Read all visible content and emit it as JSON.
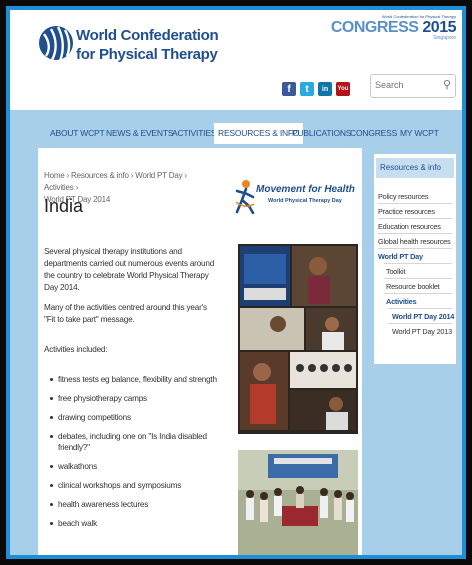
{
  "header": {
    "org_name_line1": "World Confederation",
    "org_name_line2": "for Physical Therapy",
    "congress_tiny": "World Confederation for Physical Therapy",
    "congress_word": "CONGRESS",
    "congress_year": "2015",
    "congress_city": "Singapore",
    "social": [
      "f",
      "t",
      "in",
      "You"
    ],
    "search_placeholder": "Search"
  },
  "nav": [
    "ABOUT WCPT",
    "NEWS & EVENTS",
    "ACTIVITIES",
    "RESOURCES & INFO",
    "PUBLICATIONS",
    "CONGRESS",
    "MY WCPT"
  ],
  "main": {
    "breadcrumb_line1": "Home › Resources & info › World PT Day › Activities ›",
    "breadcrumb_line2": "World PT Day 2014",
    "title": "India",
    "para1": "Several physical therapy institutions and departments carried out numerous events around the country to celebrate World Physical Therapy Day 2014.",
    "para2": "Many of the activities centred around this year's \"Fit to take part\" message.",
    "para3": "Activities included:",
    "activities": [
      "fitness tests eg balance, flexibility and strength",
      "free physiotherapy camps",
      "drawing competitions",
      "debates, including one on \"Is India disabled friendly?\"",
      "walkathons",
      "clinical workshops and symposiums",
      "health awareness lectures",
      "beach walk"
    ],
    "logo_line1": "Movement for Health",
    "logo_line2": "World Physical Therapy Day"
  },
  "sidebar": {
    "heading": "Resources & info",
    "items": [
      "Policy resources",
      "Practice resources",
      "Education resources",
      "Global health resources",
      "World PT Day",
      "Toolkit",
      "Resource booklet",
      "Activities",
      "World PT Day 2014",
      "World PT Day 2013"
    ]
  },
  "colors": {
    "brand_blue": "#1f4f8f",
    "frame_blue": "#1e8fd6",
    "band_blue": "#a8cfea"
  }
}
